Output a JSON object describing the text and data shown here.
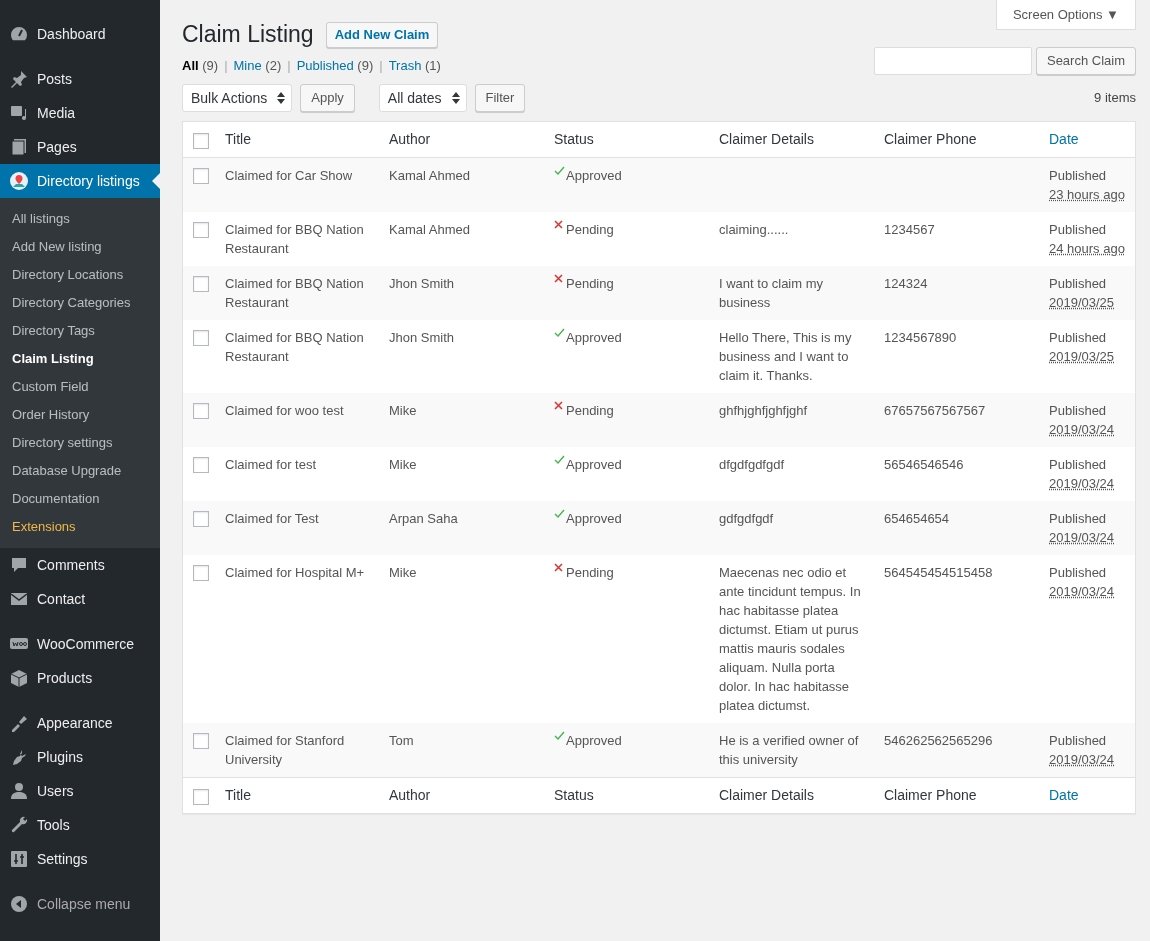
{
  "sidebar": {
    "groups": [
      [
        {
          "label": "Dashboard",
          "selected": false
        }
      ],
      [
        {
          "label": "Posts",
          "selected": false
        },
        {
          "label": "Media",
          "selected": false
        },
        {
          "label": "Pages",
          "selected": false
        },
        {
          "label": "Directory listings",
          "selected": true,
          "submenu": [
            {
              "label": "All listings",
              "selected": false,
              "kind": "normal"
            },
            {
              "label": "Add New listing",
              "selected": false,
              "kind": "normal"
            },
            {
              "label": "Directory Locations",
              "selected": false,
              "kind": "normal"
            },
            {
              "label": "Directory Categories",
              "selected": false,
              "kind": "normal"
            },
            {
              "label": "Directory Tags",
              "selected": false,
              "kind": "normal"
            },
            {
              "label": "Claim Listing",
              "selected": true,
              "kind": "normal"
            },
            {
              "label": "Custom Field",
              "selected": false,
              "kind": "normal"
            },
            {
              "label": "Order History",
              "selected": false,
              "kind": "normal"
            },
            {
              "label": "Directory settings",
              "selected": false,
              "kind": "normal"
            },
            {
              "label": "Database Upgrade",
              "selected": false,
              "kind": "normal"
            },
            {
              "label": "Documentation",
              "selected": false,
              "kind": "normal"
            },
            {
              "label": "Extensions",
              "selected": false,
              "kind": "highlight"
            }
          ]
        },
        {
          "label": "Comments",
          "selected": false
        },
        {
          "label": "Contact",
          "selected": false
        }
      ],
      [
        {
          "label": "WooCommerce",
          "selected": false
        },
        {
          "label": "Products",
          "selected": false
        }
      ],
      [
        {
          "label": "Appearance",
          "selected": false
        },
        {
          "label": "Plugins",
          "selected": false
        },
        {
          "label": "Users",
          "selected": false
        },
        {
          "label": "Tools",
          "selected": false
        },
        {
          "label": "Settings",
          "selected": false
        }
      ]
    ],
    "collapse": "Collapse menu"
  },
  "screen_options": "Screen Options ▼",
  "page_title": "Claim Listing",
  "add_button": "Add New Claim",
  "filter_separator": "|",
  "header_checkbox": {
    "checked": false
  },
  "footer_checkbox": {
    "checked": false
  },
  "filters": [
    {
      "label": "All",
      "count": "(9)",
      "selected": true
    },
    {
      "label": "Mine",
      "count": "(2)",
      "selected": false
    },
    {
      "label": "Published",
      "count": "(9)",
      "selected": false
    },
    {
      "label": "Trash",
      "count": "(1)",
      "selected": false
    }
  ],
  "search_button": "Search Claim",
  "bulk_select": "Bulk Actions",
  "apply_button": "Apply",
  "date_select": "All dates",
  "filter_button": "Filter",
  "item_count": "9 items",
  "columns": [
    {
      "label": "Title",
      "sortable": false
    },
    {
      "label": "Author",
      "sortable": false
    },
    {
      "label": "Status",
      "sortable": false
    },
    {
      "label": "Claimer Details",
      "sortable": false
    },
    {
      "label": "Claimer Phone",
      "sortable": false
    },
    {
      "label": "Date",
      "sortable": true
    }
  ],
  "rows": [
    {
      "checked": false,
      "title": "Claimed for Car Show",
      "author": "Kamal Ahmed",
      "status": {
        "label": "Approved",
        "kind": "approved"
      },
      "details": "",
      "phone": "",
      "date_label": "Published",
      "date": "23 hours ago"
    },
    {
      "checked": false,
      "title": "Claimed for BBQ Nation Restaurant",
      "author": "Kamal Ahmed",
      "status": {
        "label": "Pending",
        "kind": "pending"
      },
      "details": "claiming......",
      "phone": "1234567",
      "date_label": "Published",
      "date": "24 hours ago"
    },
    {
      "checked": false,
      "title": "Claimed for BBQ Nation Restaurant",
      "author": "Jhon Smith",
      "status": {
        "label": "Pending",
        "kind": "pending"
      },
      "details": "I want to claim my business",
      "phone": "124324",
      "date_label": "Published",
      "date": "2019/03/25"
    },
    {
      "checked": false,
      "title": "Claimed for BBQ Nation Restaurant",
      "author": "Jhon Smith",
      "status": {
        "label": "Approved",
        "kind": "approved"
      },
      "details": "Hello There, This is my business and I want to claim it. Thanks.",
      "phone": "1234567890",
      "date_label": "Published",
      "date": "2019/03/25"
    },
    {
      "checked": false,
      "title": "Claimed for woo test",
      "author": "Mike",
      "status": {
        "label": "Pending",
        "kind": "pending"
      },
      "details": "ghfhjghfjghfjghf",
      "phone": "67657567567567",
      "date_label": "Published",
      "date": "2019/03/24"
    },
    {
      "checked": false,
      "title": "Claimed for test",
      "author": "Mike",
      "status": {
        "label": "Approved",
        "kind": "approved"
      },
      "details": "dfgdfgdfgdf",
      "phone": "56546546546",
      "date_label": "Published",
      "date": "2019/03/24"
    },
    {
      "checked": false,
      "title": "Claimed for Test",
      "author": "Arpan Saha",
      "status": {
        "label": "Approved",
        "kind": "approved"
      },
      "details": "gdfgdfgdf",
      "phone": "654654654",
      "date_label": "Published",
      "date": "2019/03/24"
    },
    {
      "checked": false,
      "title": "Claimed for Hospital M+",
      "author": "Mike",
      "status": {
        "label": "Pending",
        "kind": "pending"
      },
      "details": "Maecenas nec odio et ante tincidunt tempus. In hac habitasse platea dictumst. Etiam ut purus mattis mauris sodales aliquam. Nulla porta dolor. In hac habitasse platea dictumst.",
      "phone": "564545454515458",
      "date_label": "Published",
      "date": "2019/03/24"
    },
    {
      "checked": false,
      "title": "Claimed for Stanford University",
      "author": "Tom",
      "status": {
        "label": "Approved",
        "kind": "approved"
      },
      "details": "He is a verified owner of this university",
      "phone": "546262562565296",
      "date_label": "Published",
      "date": "2019/03/24"
    }
  ],
  "footer_columns": [
    {
      "label": "Title",
      "sortable": false
    },
    {
      "label": "Author",
      "sortable": false
    },
    {
      "label": "Status",
      "sortable": false
    },
    {
      "label": "Claimer Details",
      "sortable": false
    },
    {
      "label": "Claimer Phone",
      "sortable": false
    },
    {
      "label": "Date",
      "sortable": true
    }
  ]
}
